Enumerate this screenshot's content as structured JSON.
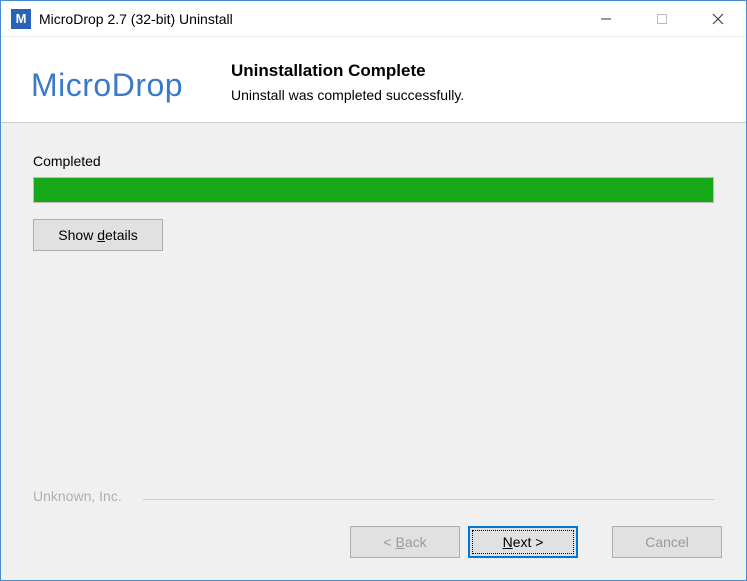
{
  "titlebar": {
    "icon_letter": "M",
    "title": "MicroDrop 2.7 (32-bit) Uninstall"
  },
  "header": {
    "logo": "MicroDrop",
    "title": "Uninstallation Complete",
    "subtitle": "Uninstall was completed successfully."
  },
  "content": {
    "status": "Completed",
    "progress_percent": 100,
    "show_details_label": "Show details",
    "show_details_underline": "d"
  },
  "branding": {
    "company": "Unknown, Inc."
  },
  "footer": {
    "back_label": "< Back",
    "back_underline": "B",
    "next_label": "Next >",
    "next_underline": "N",
    "cancel_label": "Cancel"
  }
}
